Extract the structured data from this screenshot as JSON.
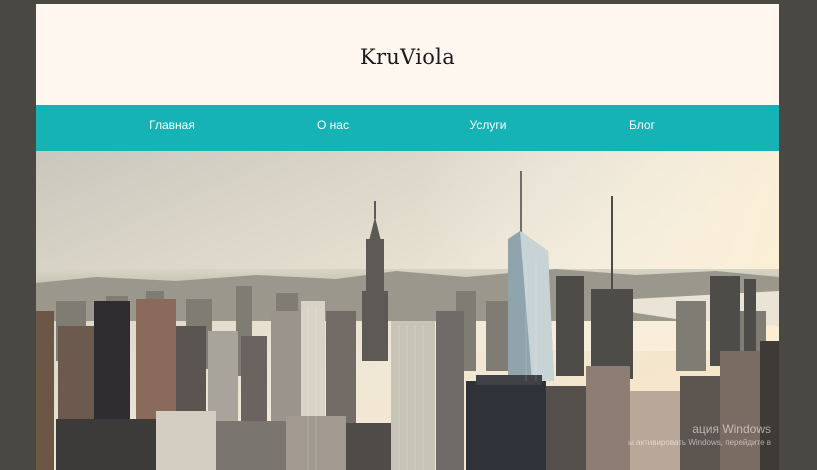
{
  "site": {
    "brand": "KruViola"
  },
  "nav": {
    "items": [
      {
        "label": "Главная"
      },
      {
        "label": "О нас"
      },
      {
        "label": "Услуги"
      },
      {
        "label": "Блог"
      }
    ]
  },
  "hero": {
    "image": "city-skyline-photo"
  },
  "watermark": {
    "line1": "ация Windows",
    "line2": "ы активировать Windows, перейдите в"
  },
  "colors": {
    "nav_bg": "#16b3b6",
    "page_bg": "#fdf7ef",
    "outer_bg": "#4a4843"
  }
}
